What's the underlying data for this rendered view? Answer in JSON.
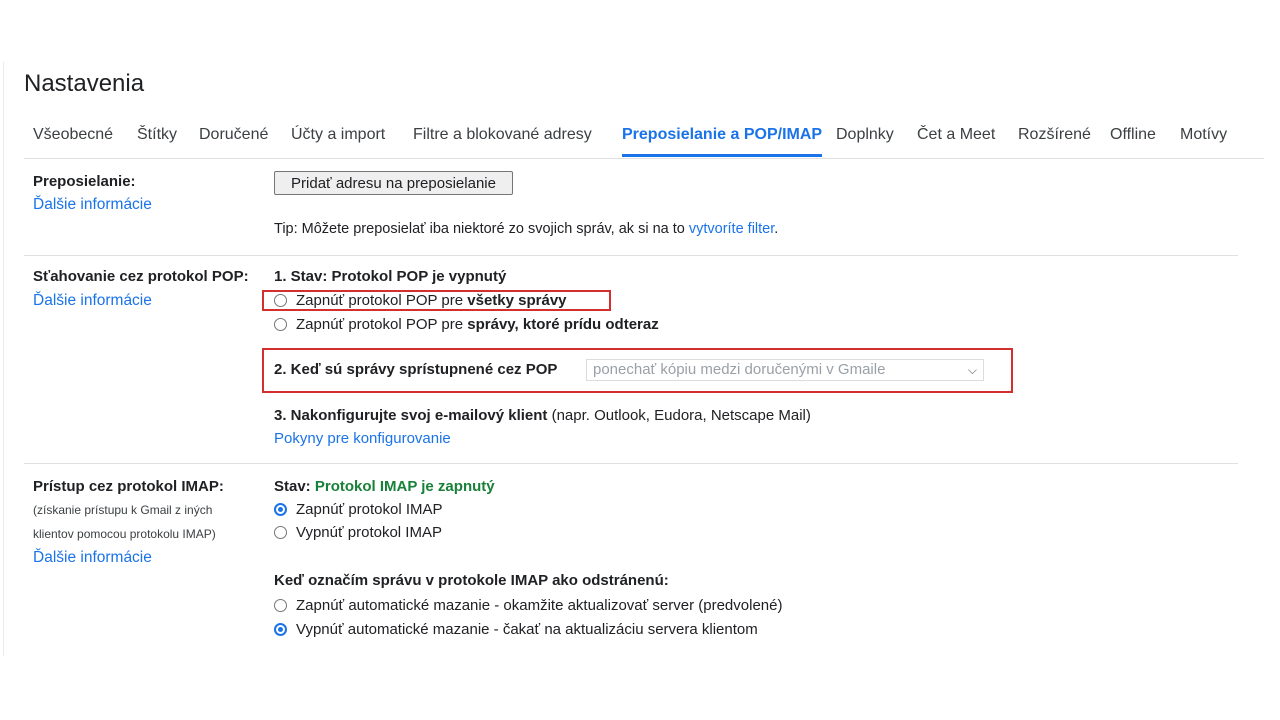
{
  "page_title": "Nastavenia",
  "tabs": [
    {
      "label": "Všeobecné"
    },
    {
      "label": "Štítky"
    },
    {
      "label": "Doručené"
    },
    {
      "label": "Účty a import"
    },
    {
      "label": "Filtre a blokované adresy"
    },
    {
      "label": "Preposielanie a POP/IMAP",
      "active": true
    },
    {
      "label": "Doplnky"
    },
    {
      "label": "Čet a Meet"
    },
    {
      "label": "Rozšírené"
    },
    {
      "label": "Offline"
    },
    {
      "label": "Motívy"
    }
  ],
  "forwarding": {
    "title": "Preposielanie:",
    "learn_more": "Ďalšie informácie",
    "add_button": "Pridať adresu na preposielanie",
    "tip_text": "Tip: Môžete preposielať iba niektoré zo svojich správ, ak si na to ",
    "tip_link": "vytvoríte filter",
    "tip_end": "."
  },
  "pop": {
    "title": "Sťahovanie cez protokol POP:",
    "learn_more": "Ďalšie informácie",
    "status": "1. Stav: Protokol POP je vypnutý",
    "option_all_prefix": "Zapnúť protokol POP pre ",
    "option_all_bold": "všetky správy",
    "option_now_prefix": "Zapnúť protokol POP pre ",
    "option_now_bold": "správy, ktoré prídu odteraz",
    "when_accessed": "2. Keď sú správy sprístupnené cez POP",
    "when_accessed_value": "ponechať kópiu medzi doručenými v Gmaile",
    "configure_bold": "3. Nakonfigurujte svoj e-mailový klient",
    "configure_rest": " (napr. Outlook, Eudora, Netscape Mail)",
    "configure_link": "Pokyny pre konfigurovanie"
  },
  "imap": {
    "title": "Prístup cez protokol IMAP:",
    "sub_line1": "(získanie prístupu k Gmail z iných",
    "sub_line2": "klientov pomocou protokolu IMAP)",
    "learn_more": "Ďalšie informácie",
    "status_label": "Stav: ",
    "status_value": "Protokol IMAP je zapnutý",
    "enable": "Zapnúť protokol IMAP",
    "disable": "Vypnúť protokol IMAP",
    "delete_heading": "Keď označím správu v protokole IMAP ako odstránenú:",
    "auto_on": "Zapnúť automatické mazanie - okamžite aktualizovať server (predvolené)",
    "auto_off": "Vypnúť automatické mazanie - čakať na aktualizáciu servera klientom"
  },
  "colors": {
    "accent": "#1a73e8",
    "highlight": "#d32f2f",
    "status_green": "#188038"
  }
}
